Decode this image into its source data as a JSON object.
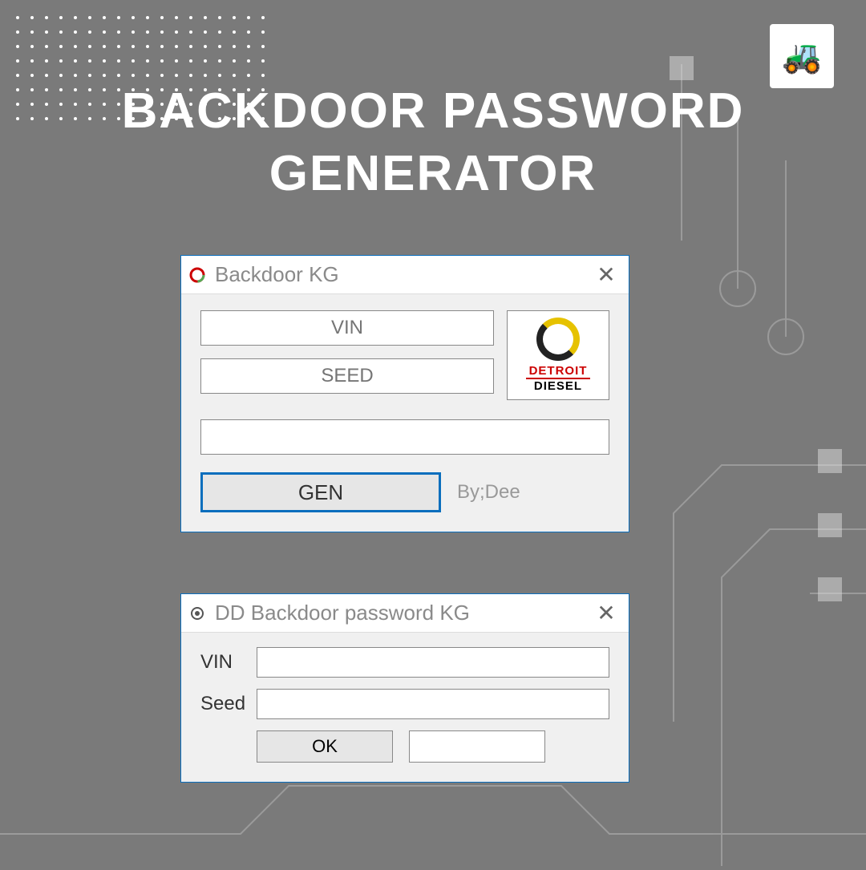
{
  "page": {
    "title_line1": "BACKDOOR PASSWORD",
    "title_line2": "GENERATOR"
  },
  "win1": {
    "title": "Backdoor KG",
    "vin_placeholder": "VIN",
    "seed_placeholder": "SEED",
    "output_value": "",
    "gen_label": "GEN",
    "credit": "By;Dee",
    "brand_line1": "DETROIT",
    "brand_line2": "DIESEL"
  },
  "win2": {
    "title": "DD Backdoor password KG",
    "vin_label": "VIN",
    "seed_label": "Seed",
    "vin_value": "",
    "seed_value": "",
    "ok_label": "OK",
    "output_value": ""
  }
}
